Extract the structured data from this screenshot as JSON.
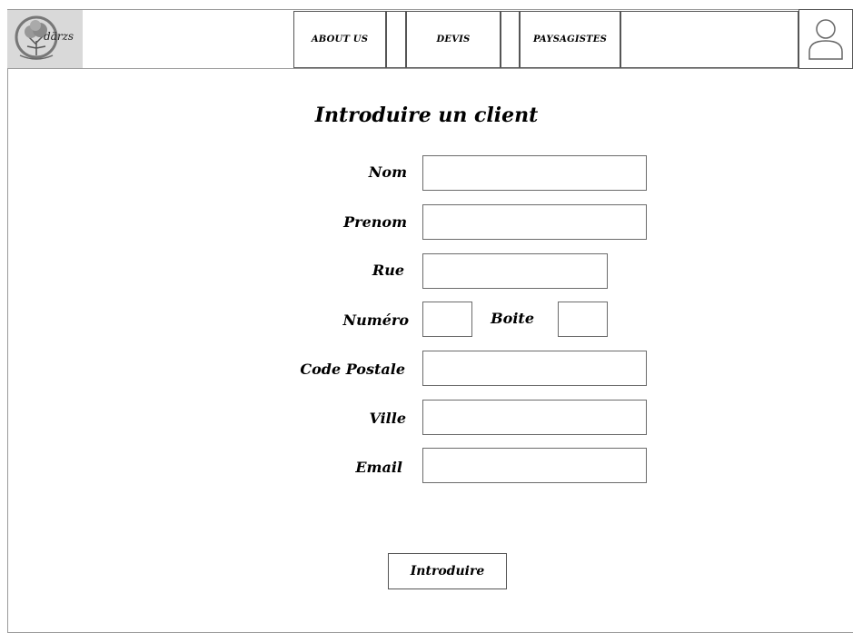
{
  "header": {
    "logo_text": "därzs",
    "nav": [
      {
        "label": "ABOUT US"
      },
      {
        "label": "DEVIS"
      },
      {
        "label": "PAYSAGISTES"
      }
    ]
  },
  "form": {
    "title": "Introduire un client",
    "fields": {
      "nom": {
        "label": "Nom",
        "value": ""
      },
      "prenom": {
        "label": "Prenom",
        "value": ""
      },
      "rue": {
        "label": "Rue",
        "value": ""
      },
      "numero": {
        "label": "Numéro",
        "value": ""
      },
      "boite": {
        "label": "Boite",
        "value": ""
      },
      "code_postale": {
        "label": "Code Postale",
        "value": ""
      },
      "ville": {
        "label": "Ville",
        "value": ""
      },
      "email": {
        "label": "Email",
        "value": ""
      }
    },
    "submit_label": "Introduire"
  },
  "icons": {
    "logo": "tree-logo-icon",
    "user": "user-avatar-icon"
  }
}
